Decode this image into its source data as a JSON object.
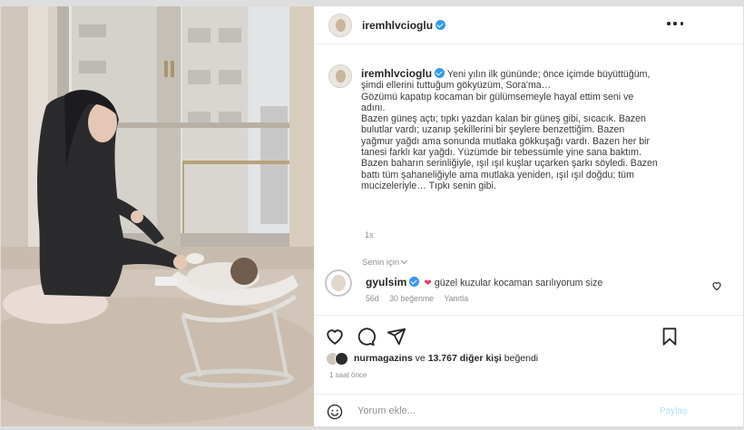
{
  "post": {
    "username": "iremhlvcioglu",
    "more_icon": "more-horizontal-icon",
    "caption_lines": [
      "Yeni yılın ilk gününde; önce içimde büyüttüğüm,",
      "şimdi ellerini tuttuğum gökyüzüm, Sora'ma…",
      "Gözümü kapatıp kocaman bir gülümsemeyle hayal ettim seni ve",
      "adını.",
      "Bazen güneş açtı; tıpkı yazdan kalan bir güneş gibi, sıcacık. Bazen",
      "bulutlar vardı; uzanıp şekillerini bir şeylere benzettiğim. Bazen",
      "yağmur yağdı ama sonunda mutlaka gökkuşağı vardı. Bazen her bir",
      "tanesi farklı kar yağdı. Yüzümde bir tebessümle yine sana baktım.",
      "Bazen baharın serinliğiyle, ışıl ışıl kuşlar uçarken şarkı söyledi. Bazen",
      "battı tüm şahaneliğiyle ama mutlaka yeniden, ışıl ışıl doğdu; tüm",
      "mucizeleriyle… Tıpkı senin gibi."
    ],
    "caption_time": "1s",
    "translate_label": "Senin için"
  },
  "comment": {
    "username": "gyulsim",
    "emoji": "❤",
    "text": "güzel kuzular kocaman sarılıyorum size",
    "age": "56d",
    "likes": "30 beğenme",
    "reply": "Yanıtla"
  },
  "actions": {
    "like_icon": "heart-icon",
    "comment_icon": "comment-icon",
    "share_icon": "share-icon",
    "save_icon": "bookmark-icon"
  },
  "likes": {
    "first_user": "nurmagazins",
    "middle": " ve ",
    "others": "13.767 diğer kişi",
    "suffix": " beğendi"
  },
  "posted_time": "1 saat önce",
  "add_comment": {
    "placeholder": "Yorum ekle...",
    "post_label": "Paylaş"
  },
  "colors": {
    "verified": "#3897f0",
    "post_button": "#b2dffc",
    "secondary_text": "#8e8e8e"
  }
}
